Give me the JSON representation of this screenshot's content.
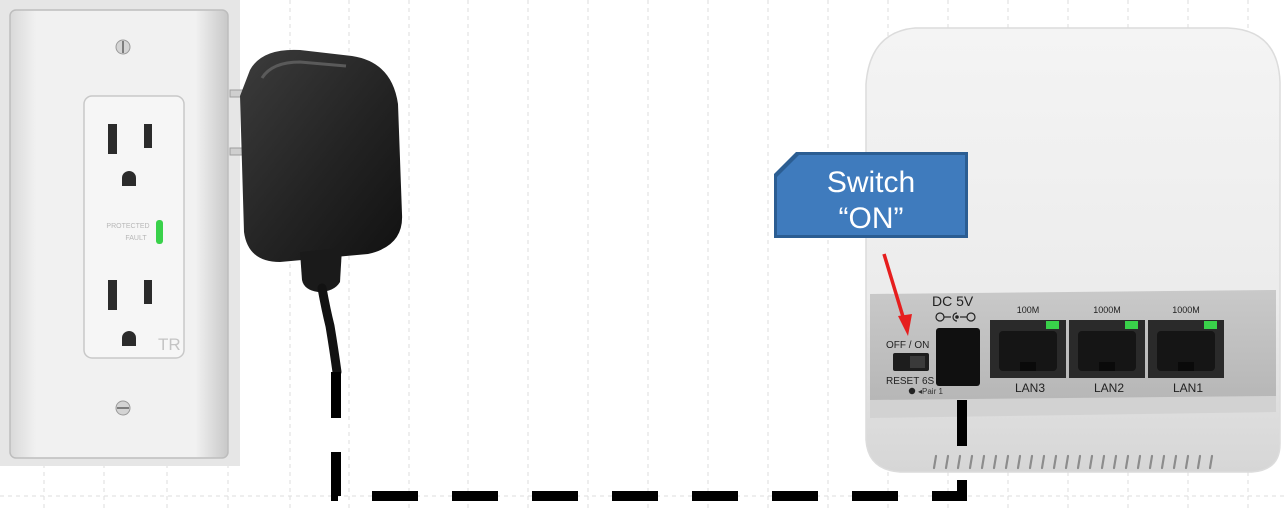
{
  "callout": {
    "line1": "Switch",
    "line2": "“ON”"
  },
  "outlet": {
    "indicator_label_1": "PROTECTED",
    "indicator_label_2": "FAULT",
    "tr_mark": "TR"
  },
  "router": {
    "dc_label": "DC 5V",
    "switch_label": "OFF / ON",
    "reset_label": "RESET 6S",
    "pair_label": "◂Pair 1",
    "ports": [
      {
        "speed": "100M",
        "name": "LAN3"
      },
      {
        "speed": "1000M",
        "name": "LAN2"
      },
      {
        "speed": "1000M",
        "name": "LAN1"
      }
    ]
  },
  "colors": {
    "callout_fill": "#3f7bbd",
    "callout_border": "#2b5d92",
    "arrow": "#e61e1e",
    "led": "#39d14a",
    "cable": "#000000"
  }
}
